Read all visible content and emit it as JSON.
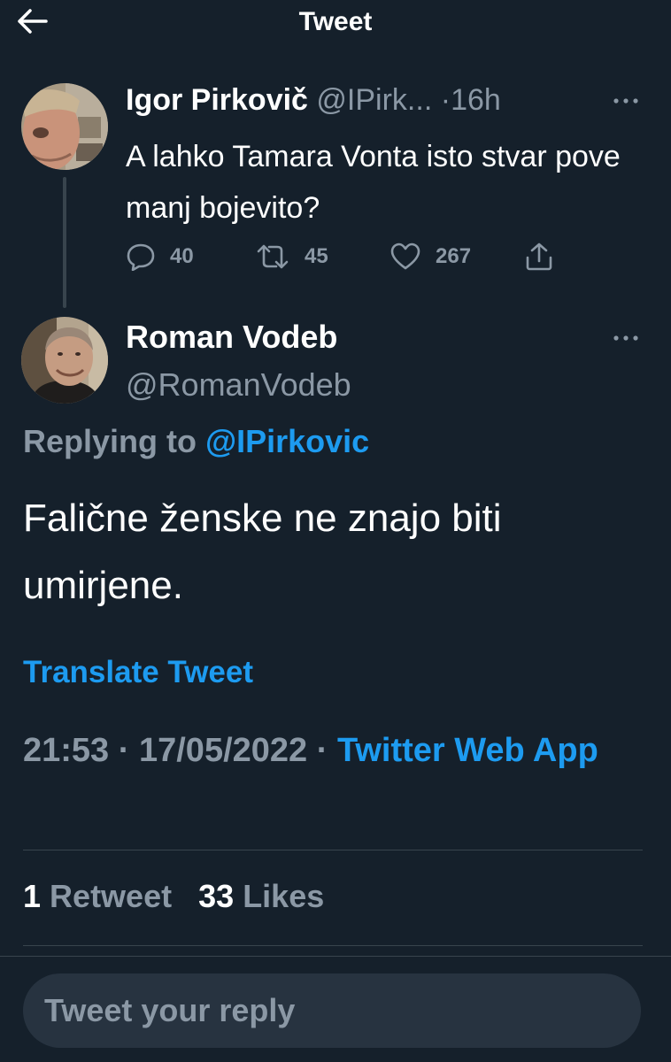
{
  "header": {
    "title": "Tweet",
    "back_icon": "arrow-left-icon"
  },
  "parent_tweet": {
    "display_name": "Igor Pirkovič",
    "handle": "@IPirk...",
    "separator": "·",
    "time": "16h",
    "text": "A lahko Tamara Vonta isto stvar pove manj bojevito?",
    "replies": "40",
    "retweets": "45",
    "likes": "267"
  },
  "main_tweet": {
    "display_name": "Roman Vodeb",
    "handle": "@RomanVodeb",
    "replying_prefix": "Replying to",
    "replying_handle": "@IPirkovic",
    "text": "Falične ženske ne znajo biti umirjene.",
    "translate_label": "Translate Tweet",
    "time": "21:53",
    "date": "17/05/2022",
    "separator": "·",
    "source": "Twitter Web App",
    "retweet_count": "1",
    "retweet_label": "Retweet",
    "like_count": "33",
    "like_label": "Likes"
  },
  "reply_box": {
    "placeholder": "Tweet your reply"
  },
  "colors": {
    "background": "#15202b",
    "accent": "#1d9bf0",
    "muted": "#8b98a5",
    "divider": "#38444d",
    "reply_box": "#273340"
  }
}
